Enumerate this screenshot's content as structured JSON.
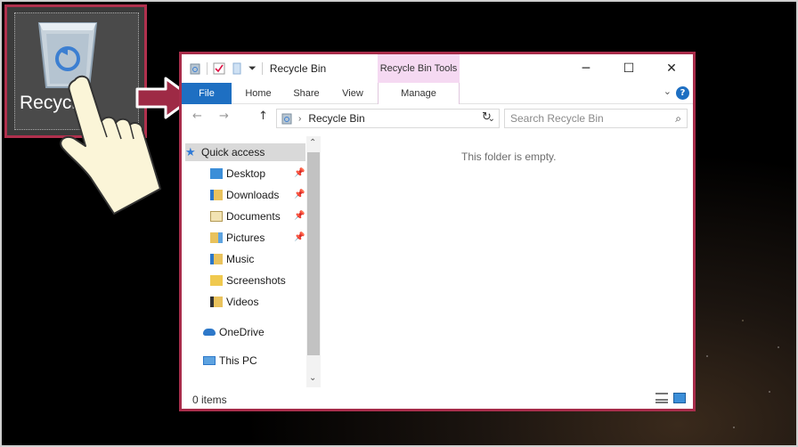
{
  "desktop": {
    "recycle_icon": {
      "label": "Recycle",
      "icon": "recycle-bin-icon"
    },
    "pointer": "hand-pointer-icon",
    "callout": "arrow-right-icon"
  },
  "window": {
    "title": "Recycle Bin",
    "contextual_tab": "Recycle Bin Tools",
    "controls": {
      "minimize": "─",
      "maximize": "☐",
      "close": "✕"
    },
    "ribbon_tabs": [
      "File",
      "Home",
      "Share",
      "View",
      "Manage"
    ],
    "help": "?",
    "address": {
      "back": "←",
      "forward": "→",
      "up": "↑",
      "path": "Recycle Bin",
      "separator": "›",
      "dropdown": "⌄",
      "refresh": "↻"
    },
    "search": {
      "placeholder": "Search Recycle Bin",
      "icon": "⌕"
    },
    "nav_pane": {
      "quick_access": "Quick access",
      "items": [
        {
          "label": "Desktop",
          "pinned": true,
          "icon": "desktop-folder-icon"
        },
        {
          "label": "Downloads",
          "pinned": true,
          "icon": "downloads-folder-icon"
        },
        {
          "label": "Documents",
          "pinned": true,
          "icon": "documents-folder-icon"
        },
        {
          "label": "Pictures",
          "pinned": true,
          "icon": "pictures-folder-icon"
        },
        {
          "label": "Music",
          "pinned": false,
          "icon": "music-folder-icon"
        },
        {
          "label": "Screenshots",
          "pinned": false,
          "icon": "screenshots-folder-icon"
        },
        {
          "label": "Videos",
          "pinned": false,
          "icon": "videos-folder-icon"
        }
      ],
      "onedrive": "OneDrive",
      "this_pc": "This PC"
    },
    "content": {
      "empty_message": "This folder is empty."
    },
    "status": {
      "item_count": "0 items"
    }
  },
  "colors": {
    "highlight_border": "#a82c4a",
    "file_tab": "#1e6fc2",
    "context_tab": "#f5d9f2"
  }
}
